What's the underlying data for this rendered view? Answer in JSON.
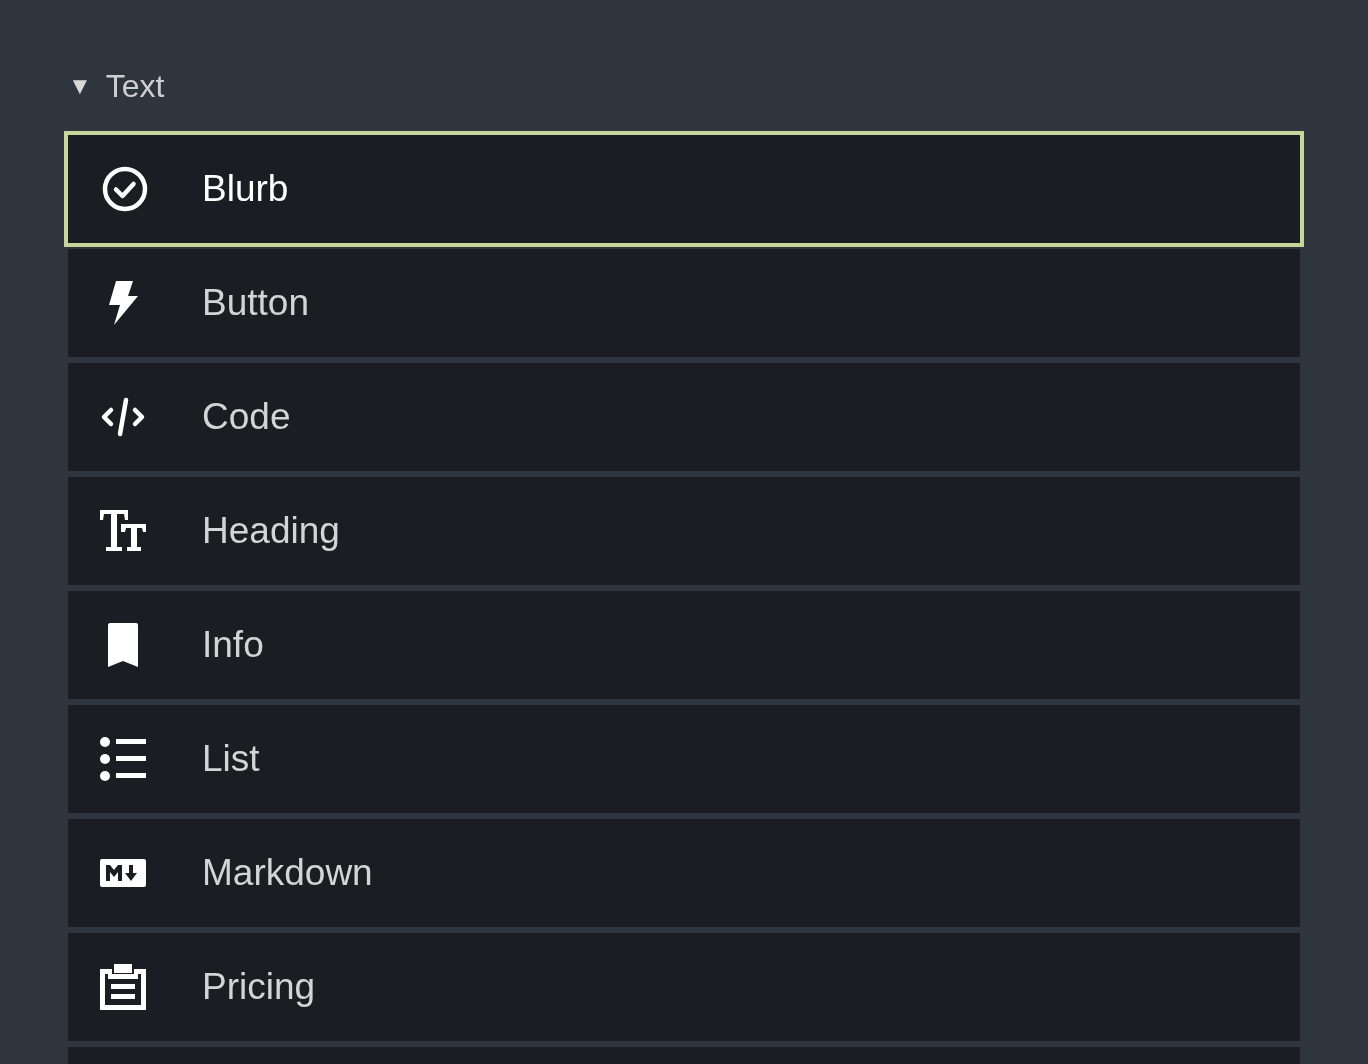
{
  "section": {
    "toggle": "▼",
    "title": "Text",
    "expanded": true,
    "items": [
      {
        "label": "Blurb",
        "selected": true
      },
      {
        "label": "Button",
        "selected": false
      },
      {
        "label": "Code",
        "selected": false
      },
      {
        "label": "Heading",
        "selected": false
      },
      {
        "label": "Info",
        "selected": false
      },
      {
        "label": "List",
        "selected": false
      },
      {
        "label": "Markdown",
        "selected": false
      },
      {
        "label": "Pricing",
        "selected": false
      }
    ]
  }
}
